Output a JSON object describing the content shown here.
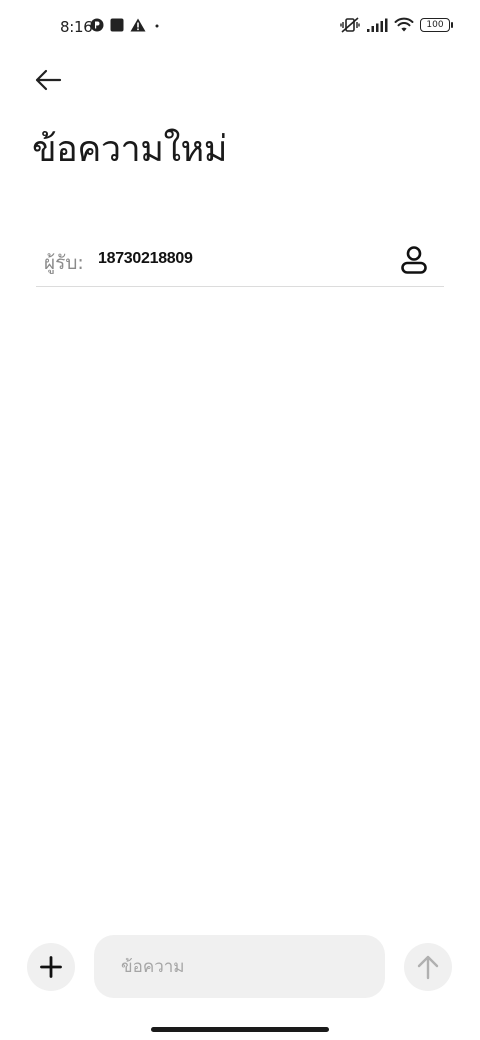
{
  "status_bar": {
    "time": "8:16",
    "battery": "100",
    "left_icons": [
      "notification-app-icon",
      "square-notification-icon",
      "warning-icon",
      "dot-icon"
    ],
    "right_icons": [
      "vibrate-off-icon",
      "signal-icon",
      "wifi-icon",
      "battery-icon"
    ]
  },
  "header": {
    "back_icon": "arrow-left-icon",
    "title": "ข้อความใหม่"
  },
  "recipient": {
    "label": "ผู้รับ:",
    "value": "18730218809",
    "contact_icon": "person-icon"
  },
  "compose": {
    "attach_icon": "plus-icon",
    "placeholder": "ข้อความ",
    "value": "",
    "send_icon": "arrow-up-icon"
  },
  "colors": {
    "background": "#ffffff",
    "control_fill": "#f0f0f0",
    "divider": "#dcdcdc",
    "muted_text": "#8a8a8a",
    "disabled_icon": "#b0b0b0"
  }
}
